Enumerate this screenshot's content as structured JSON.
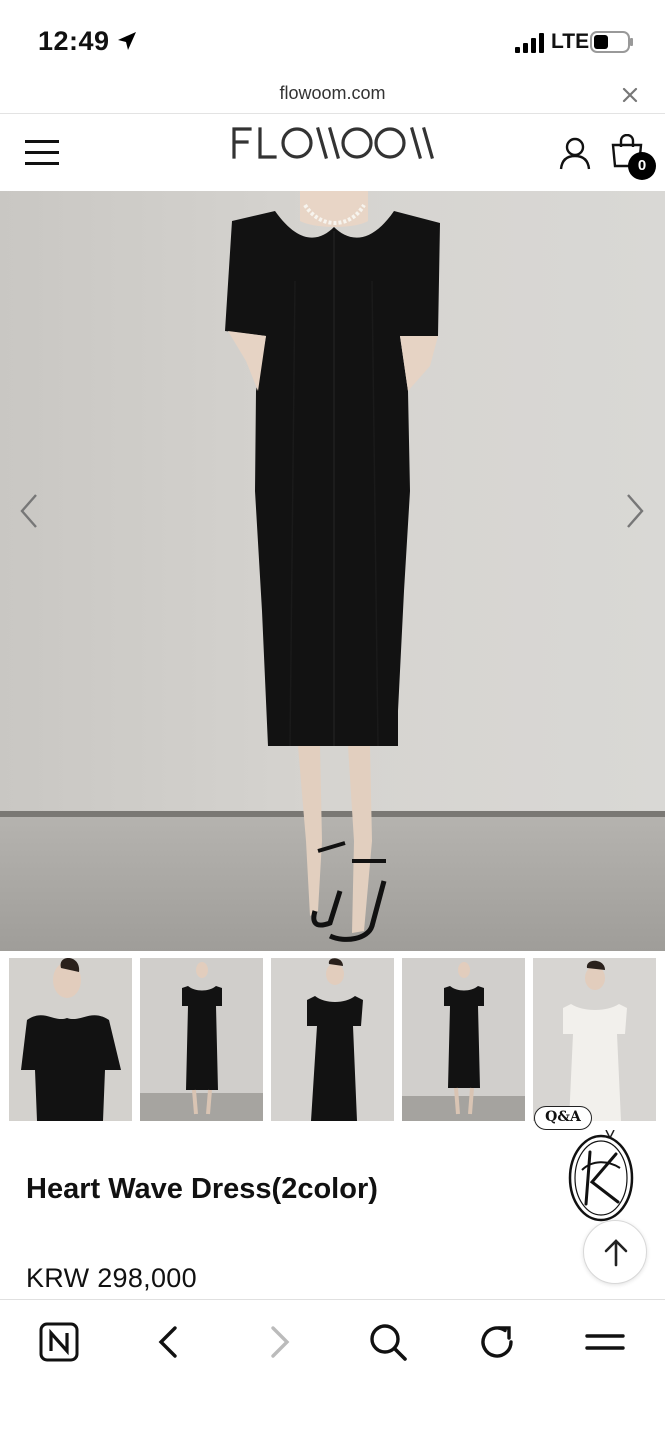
{
  "status_bar": {
    "time": "12:49",
    "network": "LTE",
    "icons": [
      "location-arrow-icon",
      "signal-bars-icon",
      "battery-icon"
    ]
  },
  "browser": {
    "url": "flowoom.com",
    "close_icon": "close-icon"
  },
  "site_header": {
    "logo_text": "FLOWOOM",
    "cart_count": "0",
    "icons": [
      "menu-icon",
      "user-icon",
      "shopping-bag-icon"
    ]
  },
  "gallery": {
    "main_image": "black-heart-wave-dress-model",
    "thumbnails": [
      {
        "label": "black dress close-up"
      },
      {
        "label": "black dress full length front"
      },
      {
        "label": "black dress three-quarter"
      },
      {
        "label": "black dress full length"
      },
      {
        "label": "white dress"
      }
    ],
    "nav_icons": [
      "chevron-left-icon",
      "chevron-right-icon"
    ]
  },
  "product": {
    "title": "Heart Wave Dress(2color)",
    "price": "KRW 298,000"
  },
  "floating": {
    "qa_label": "Q&A",
    "scroll_top_icon": "arrow-up-icon"
  },
  "bottom_toolbar": {
    "icons": [
      "naver-n-icon",
      "back-icon",
      "forward-icon",
      "search-icon",
      "reload-icon",
      "menu-icon"
    ]
  },
  "colors": {
    "dress_black": "#111111",
    "dress_white": "#f2f0ec",
    "wall": "#cfcdc9",
    "floor": "#a9a7a3",
    "text": "#111111"
  }
}
